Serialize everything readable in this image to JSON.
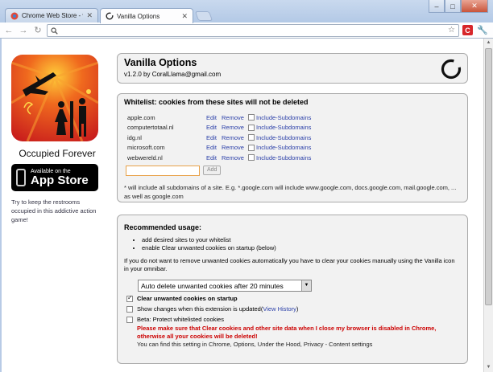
{
  "browser": {
    "tabs": [
      {
        "title": "Chrome Web Store - vanilla",
        "active": false
      },
      {
        "title": "Vanilla Options",
        "active": true
      }
    ],
    "address": ""
  },
  "ad": {
    "title": "Occupied Forever",
    "store_small": "Available on the",
    "store_big": "App Store",
    "description": "Try to keep the restrooms occupied in this addictive action game!"
  },
  "header": {
    "title": "Vanilla Options",
    "version_line": "v1.2.0 by CoralLlama@gmail.com"
  },
  "whitelist": {
    "title": "Whitelist: cookies from these sites will not be deleted",
    "edit_label": "Edit",
    "remove_label": "Remove",
    "subdomains_label": "Include-Subdomains",
    "domains": [
      "apple.com",
      "computertotaal.nl",
      "idg.nl",
      "microsoft.com",
      "webwereld.nl"
    ],
    "add_label": "Add",
    "add_value": "",
    "note": "* will include all subdomains of a site. E.g. *.google.com will include www.google.com, docs.google.com, mail.google.com, ... as well as google.com"
  },
  "usage": {
    "title": "Recommended usage:",
    "items": [
      "add desired sites to your whitelist",
      "enable Clear unwanted cookies on startup (below)"
    ],
    "para": "If you do not want to remove unwanted cookies automatically you have to clear your cookies manually using the Vanilla icon in your omnibar.",
    "select_value": "Auto delete unwanted cookies after 20 minutes",
    "opt_startup": "Clear unwanted cookies on startup",
    "opt_changes": "Show changes when this extension is updated",
    "opt_changes_link": "View History",
    "opt_beta": "Beta: Protect whitelisted cookies",
    "warn_red": "Please make sure that Clear cookies and other site data when I close my browser is disabled in Chrome, otherwise all your cookies will be deleted!",
    "warn_plain": "You can find this setting in Chrome, Options, Under the Hood, Privacy - Content settings"
  },
  "colors": {
    "link": "#2a3fa8",
    "warning": "#cc0000",
    "panel": "#f2f2f2"
  }
}
